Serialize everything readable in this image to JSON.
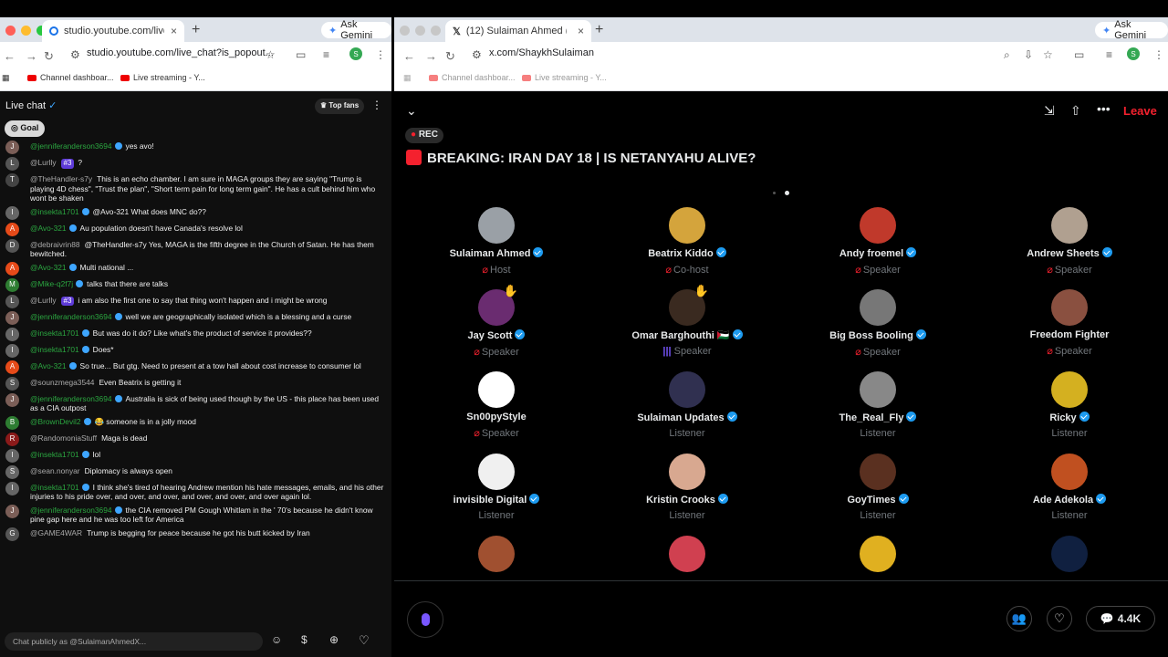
{
  "left_window": {
    "tab_title": "studio.youtube.com/live_chat?",
    "ask_gemini": "Ask Gemini",
    "url": "studio.youtube.com/live_chat?is_popout...",
    "bookmarks": [
      "Channel dashboar...",
      "Live streaming - Y..."
    ],
    "chat_title": "Live chat",
    "top_fans": "Top fans",
    "goal_label": "Goal",
    "input_placeholder": "Chat publicly as @SulaimanAhmedX...",
    "messages": [
      {
        "author": "@jenniferanderson3694",
        "text": "yes avo!",
        "color": "#7b5e57",
        "init": "J",
        "green": true
      },
      {
        "author": "@Lurlly",
        "badge": "#3",
        "text": "?",
        "color": "#555",
        "init": "L",
        "green": false
      },
      {
        "author": "@TheHandler-s7y",
        "text": "This is an echo chamber. I am sure in MAGA groups they are saying \"Trump is playing 4D chess\", \"Trust the plan\", \"Short term pain for long term gain\". He has a cult behind him who wont be shaken",
        "color": "#444",
        "init": "T",
        "green": false
      },
      {
        "author": "@insekta1701",
        "text": "@Avo-321 What does MNC do??",
        "color": "#666",
        "init": "I",
        "green": true
      },
      {
        "author": "@Avo-321",
        "text": "Au population doesn't have Canada's resolve lol",
        "color": "#e64a19",
        "init": "A",
        "green": true
      },
      {
        "author": "@debraivrin88",
        "text": "@TheHandler-s7y Yes, MAGA is the fifth degree in the Church of Satan. He has them bewitched.",
        "color": "#555",
        "init": "D",
        "green": false
      },
      {
        "author": "@Avo-321",
        "text": "Multi national ...",
        "color": "#e64a19",
        "init": "A",
        "green": true
      },
      {
        "author": "@Mike-q2f7j",
        "text": "talks that there are talks",
        "color": "#2e7d32",
        "init": "M",
        "green": true
      },
      {
        "author": "@Lurlly",
        "badge": "#3",
        "text": "i am also the first one to say that thing won't happen and i might be wrong",
        "color": "#555",
        "init": "L",
        "green": false
      },
      {
        "author": "@jenniferanderson3694",
        "text": "well we are geographically isolated which is a blessing and a curse",
        "color": "#7b5e57",
        "init": "J",
        "green": true
      },
      {
        "author": "@insekta1701",
        "text": "But was do it do? Like what's the product of service it provides??",
        "color": "#666",
        "init": "I",
        "green": true
      },
      {
        "author": "@insekta1701",
        "text": "Does*",
        "color": "#666",
        "init": "I",
        "green": true
      },
      {
        "author": "@Avo-321",
        "text": "So true... But gtg. Need to present at a tow hall about cost increase to consumer lol",
        "color": "#e64a19",
        "init": "A",
        "green": true
      },
      {
        "author": "@sounzmega3544",
        "text": "Even Beatrix is getting it",
        "color": "#555",
        "init": "S",
        "green": false
      },
      {
        "author": "@jenniferanderson3694",
        "text": "Australia is sick of being used though by the US - this place has been used as a CIA outpost",
        "color": "#7b5e57",
        "init": "J",
        "green": true
      },
      {
        "author": "@BrownDevil2",
        "text": "😂 someone is in a jolly mood",
        "color": "#2e7d32",
        "init": "B",
        "green": true
      },
      {
        "author": "@RandomoniaStuff",
        "text": "Maga is dead",
        "color": "#8b1a1a",
        "init": "R",
        "green": false
      },
      {
        "author": "@insekta1701",
        "text": "lol",
        "color": "#666",
        "init": "I",
        "green": true
      },
      {
        "author": "@sean.nonyar",
        "text": "Diplomacy is always open",
        "color": "#666",
        "init": "S",
        "green": false
      },
      {
        "author": "@insekta1701",
        "text": "I think she's tired of hearing Andrew mention his hate messages, emails, and his other injuries to his pride over, and over, and over, and over, and over, and over again lol.",
        "color": "#666",
        "init": "I",
        "green": true
      },
      {
        "author": "@jenniferanderson3694",
        "text": "the CIA removed PM Gough Whitlam in the ' 70's because he didn't know pine gap here and he was too left for America",
        "color": "#7b5e57",
        "init": "J",
        "green": true
      },
      {
        "author": "@GAME4WAR",
        "text": "Trump is begging for peace because he got his butt kicked by Iran",
        "color": "#555",
        "init": "G",
        "green": false
      }
    ]
  },
  "right_window": {
    "tab_title": "(12) Sulaiman Ahmed (@S",
    "ask_gemini": "Ask Gemini",
    "url": "x.com/ShaykhSulaiman",
    "bookmarks": [
      "Channel dashboar...",
      "Live streaming - Y..."
    ],
    "leave": "Leave",
    "rec": "REC",
    "space_title": "BREAKING: IRAN DAY 18 | IS NETANYAHU ALIVE?",
    "listener_count": "4.4K",
    "participants": [
      {
        "name": "Sulaiman Ahmed",
        "role": "Host",
        "verified": true,
        "mic": true,
        "color": "#9aa0a6"
      },
      {
        "name": "Beatrix Kiddo",
        "role": "Co-host",
        "verified": true,
        "mic": true,
        "color": "#d4a43c"
      },
      {
        "name": "Andy froemel",
        "role": "Speaker",
        "verified": true,
        "mic": true,
        "color": "#c0392b"
      },
      {
        "name": "Andrew Sheets",
        "role": "Speaker",
        "verified": true,
        "mic": true,
        "color": "#b0a090"
      },
      {
        "name": "Jay Scott",
        "role": "Speaker",
        "verified": true,
        "mic": true,
        "color": "#6a2c70",
        "hand": true
      },
      {
        "name": "Omar Barghouthi 🇵🇸",
        "role": "Speaker",
        "verified": true,
        "mic": false,
        "bars": true,
        "color": "#3a2a20",
        "hand": true
      },
      {
        "name": "Big Boss Booling",
        "role": "Speaker",
        "verified": true,
        "mic": true,
        "color": "#777"
      },
      {
        "name": "Freedom Fighter",
        "role": "Speaker",
        "verified": false,
        "mic": true,
        "color": "#8a5040"
      },
      {
        "name": "Sn00pyStyle",
        "role": "Speaker",
        "verified": false,
        "mic": true,
        "color": "#ffffff"
      },
      {
        "name": "Sulaiman Updates",
        "role": "Listener",
        "verified": true,
        "mic": false,
        "color": "#303050"
      },
      {
        "name": "The_Real_Fly",
        "role": "Listener",
        "verified": true,
        "mic": false,
        "color": "#888"
      },
      {
        "name": "Ricky",
        "role": "Listener",
        "verified": true,
        "mic": false,
        "color": "#d4b020"
      },
      {
        "name": "invisible Digital",
        "role": "Listener",
        "verified": true,
        "mic": false,
        "color": "#f0f0f0"
      },
      {
        "name": "Kristin Crooks",
        "role": "Listener",
        "verified": true,
        "mic": false,
        "color": "#d8a890"
      },
      {
        "name": "GoyTimes",
        "role": "Listener",
        "verified": true,
        "mic": false,
        "color": "#5a3020"
      },
      {
        "name": "Ade Adekola",
        "role": "Listener",
        "verified": true,
        "mic": false,
        "color": "#c05020"
      },
      {
        "name": "",
        "role": "",
        "color": "#a05030"
      },
      {
        "name": "",
        "role": "",
        "color": "#d04050"
      },
      {
        "name": "",
        "role": "",
        "color": "#e0b020"
      },
      {
        "name": "",
        "role": "",
        "color": "#102040"
      }
    ]
  }
}
